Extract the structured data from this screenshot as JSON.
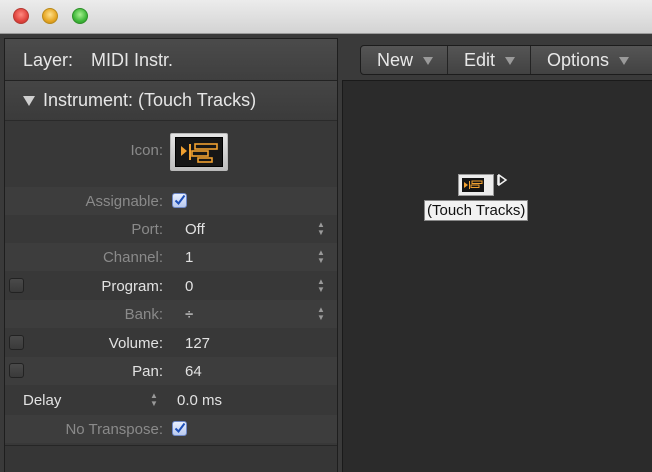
{
  "window": {
    "controls": [
      "close",
      "minimize",
      "zoom"
    ]
  },
  "inspector": {
    "layer_label": "Layer:",
    "layer_value": "MIDI Instr.",
    "section_title": "Instrument: (Touch Tracks)",
    "icon_label": "Icon:",
    "assignable_label": "Assignable:",
    "port_label": "Port:",
    "port_value": "Off",
    "channel_label": "Channel:",
    "channel_value": "1",
    "program_label": "Program:",
    "program_value": "0",
    "bank_label": "Bank:",
    "bank_value": "÷",
    "volume_label": "Volume:",
    "volume_value": "127",
    "pan_label": "Pan:",
    "pan_value": "64",
    "delay_label": "Delay",
    "delay_value": "0.0 ms",
    "no_transpose_label": "No Transpose:"
  },
  "toolbar": {
    "new_label": "New",
    "edit_label": "Edit",
    "options_label": "Options"
  },
  "canvas": {
    "object_label": "(Touch Tracks)"
  },
  "colors": {
    "accent_orange": "#f0a030",
    "checkbox_blue": "#3a66c8"
  }
}
